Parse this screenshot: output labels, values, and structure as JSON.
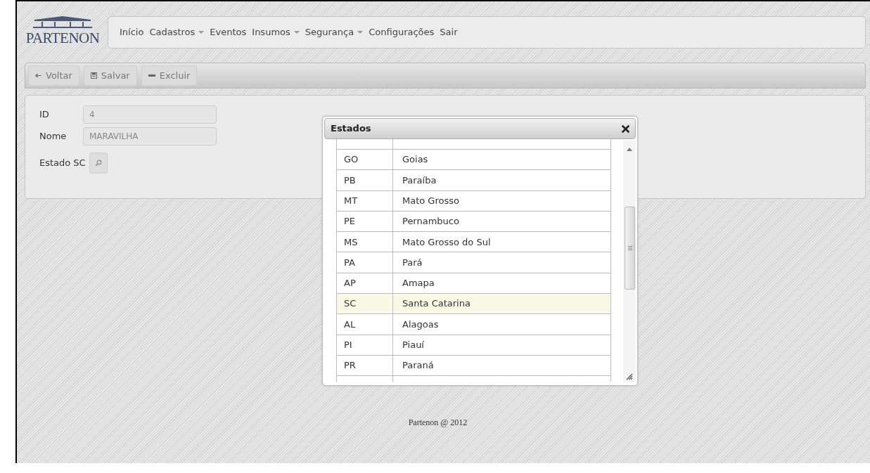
{
  "logo": {
    "text": "PARTENON"
  },
  "menu": [
    {
      "label": "Início",
      "dropdown": false
    },
    {
      "label": "Cadastros",
      "dropdown": true
    },
    {
      "label": "Eventos",
      "dropdown": false
    },
    {
      "label": "Insumos",
      "dropdown": true
    },
    {
      "label": "Segurança",
      "dropdown": true
    },
    {
      "label": "Configurações",
      "dropdown": false
    },
    {
      "label": "Sair",
      "dropdown": false
    }
  ],
  "toolbar": [
    "Voltar",
    "Salvar",
    "Excluir"
  ],
  "form": {
    "fields": [
      {
        "label": "ID",
        "value": "4",
        "disabled": true
      },
      {
        "label": "Nome",
        "value": "MARAVILHA",
        "disabled": true
      }
    ],
    "estado": {
      "label": "Estado",
      "value": "SC"
    }
  },
  "dialog": {
    "title": "Estados",
    "rows": [
      {
        "code": "GO",
        "name": "Goias",
        "selected": false
      },
      {
        "code": "PB",
        "name": "Paraíba",
        "selected": false
      },
      {
        "code": "MT",
        "name": "Mato Grosso",
        "selected": false
      },
      {
        "code": "PE",
        "name": "Pernambuco",
        "selected": false
      },
      {
        "code": "MS",
        "name": "Mato Grosso do Sul",
        "selected": false
      },
      {
        "code": "PA",
        "name": "Pará",
        "selected": false
      },
      {
        "code": "AP",
        "name": "Amapa",
        "selected": false
      },
      {
        "code": "SC",
        "name": "Santa Catarina",
        "selected": true
      },
      {
        "code": "AL",
        "name": "Alagoas",
        "selected": false
      },
      {
        "code": "PI",
        "name": "Piauí",
        "selected": false
      },
      {
        "code": "PR",
        "name": "Paraná",
        "selected": false
      }
    ]
  },
  "footer": "Partenon @ 2012"
}
